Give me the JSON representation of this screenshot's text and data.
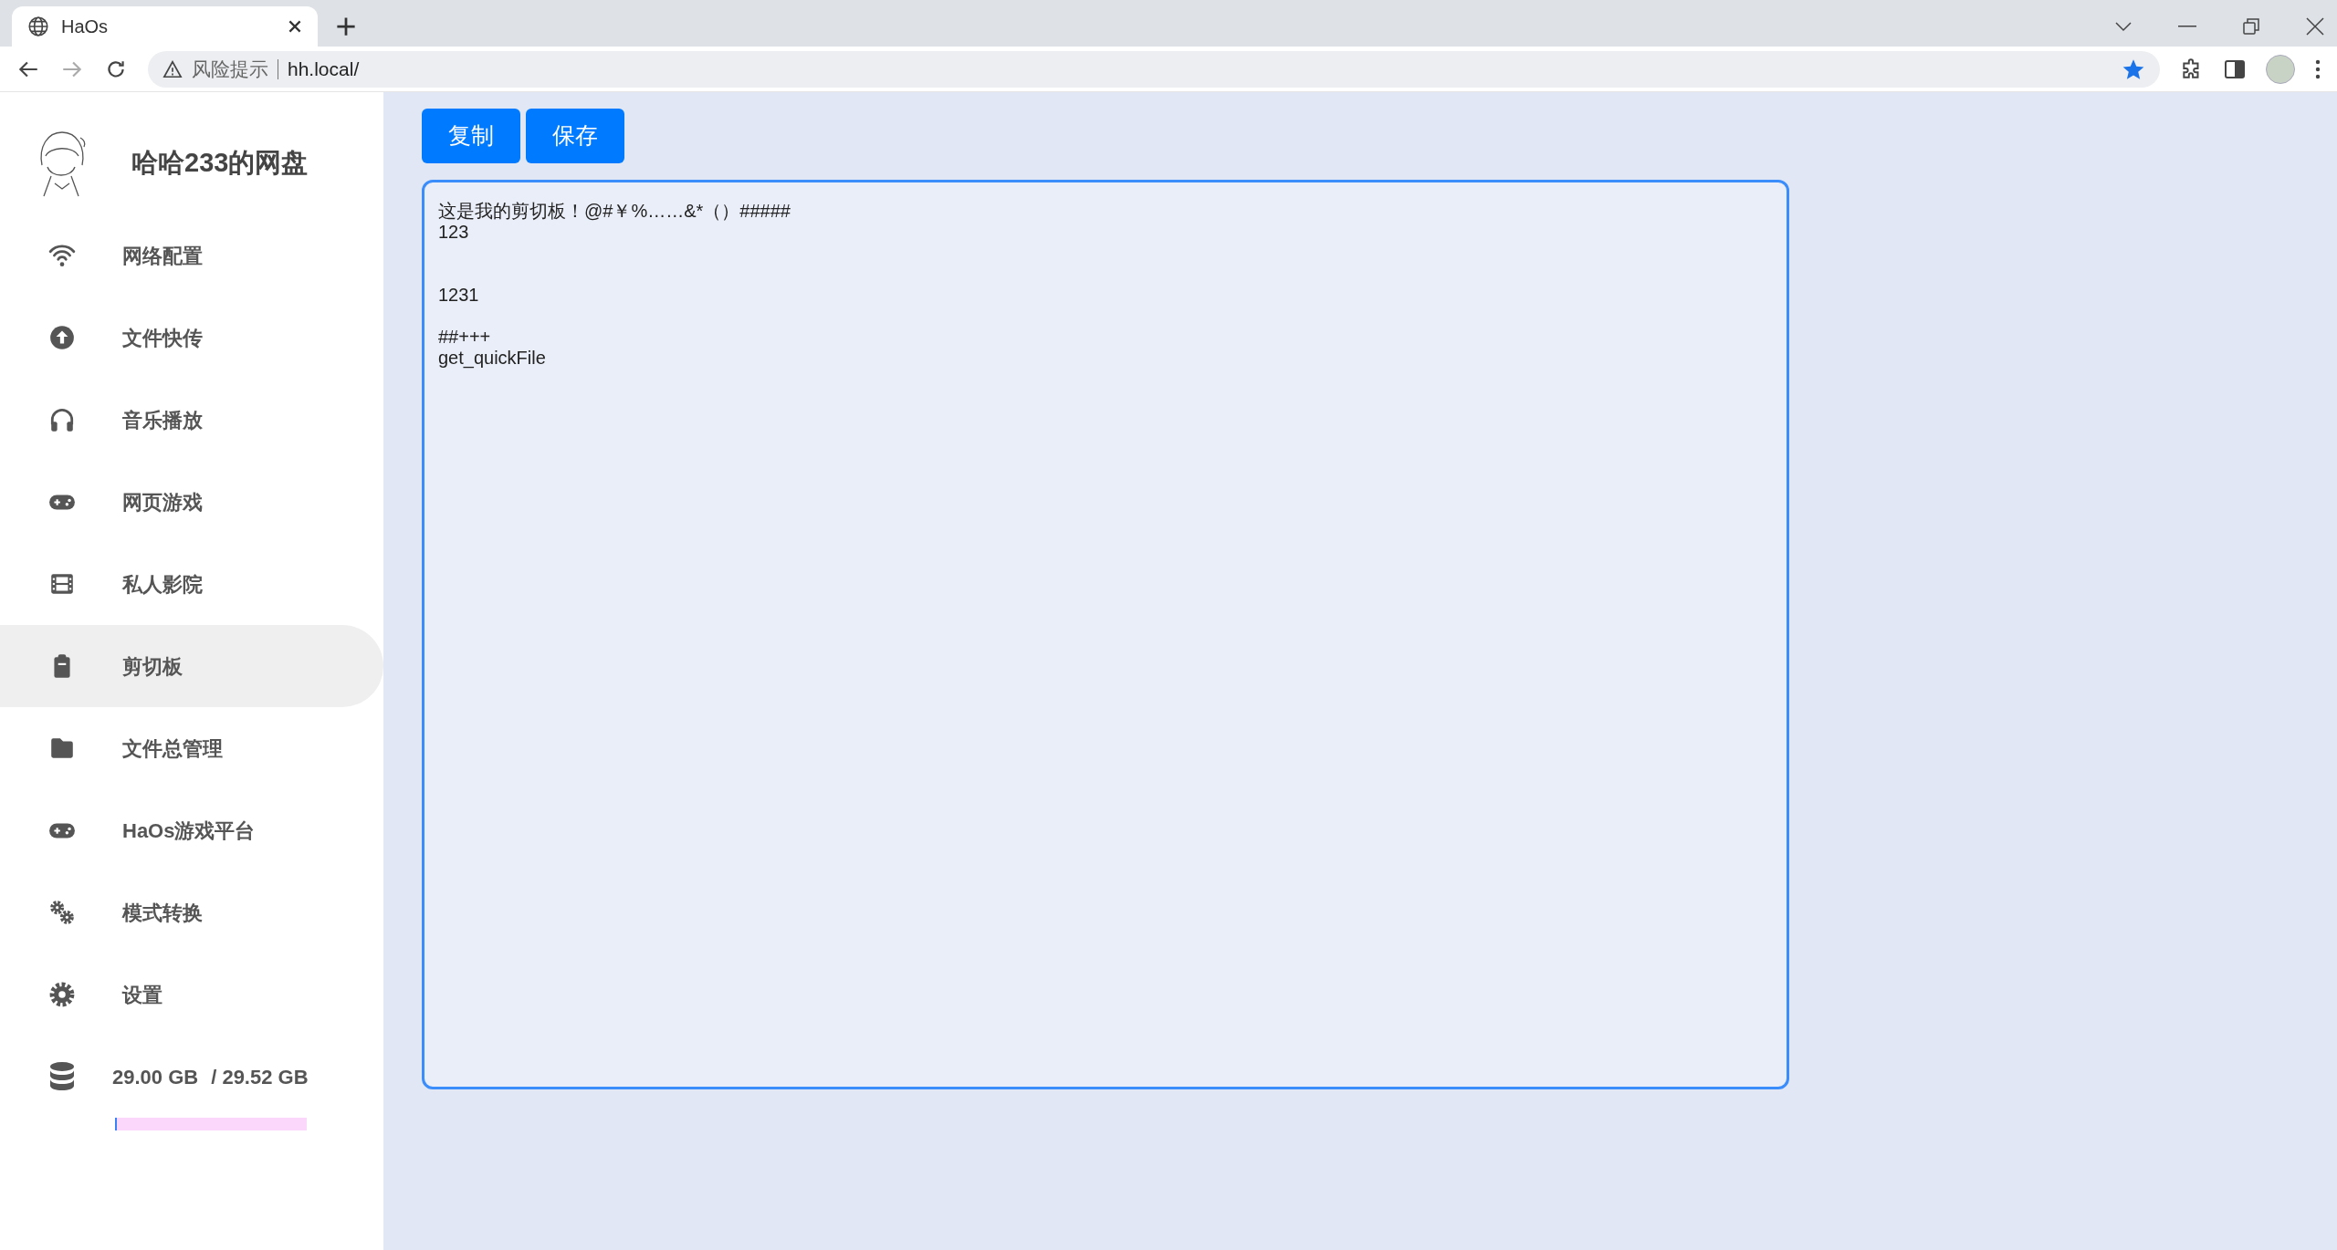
{
  "browser": {
    "tab_title": "HaOs",
    "security_label": "风险提示",
    "url": "hh.local/",
    "bookmarked": true
  },
  "sidebar": {
    "title": "哈哈233的网盘",
    "items": [
      {
        "label": "网络配置",
        "selected": false
      },
      {
        "label": "文件快传",
        "selected": false
      },
      {
        "label": "音乐播放",
        "selected": false
      },
      {
        "label": "网页游戏",
        "selected": false
      },
      {
        "label": "私人影院",
        "selected": false
      },
      {
        "label": "剪切板",
        "selected": true
      },
      {
        "label": "文件总管理",
        "selected": false
      },
      {
        "label": "HaOs游戏平台",
        "selected": false
      },
      {
        "label": "模式转换",
        "selected": false
      },
      {
        "label": "设置",
        "selected": false
      }
    ],
    "storage": {
      "used": "29.00 GB",
      "total": "/ 29.52 GB",
      "level": 0.01
    }
  },
  "buttons": [
    "复制",
    "保存"
  ],
  "clipboard": {
    "value": "这是我的剪切板！@#￥%……&*（）#####\n123\n\n\n1231\n\n##+++\nget_quickFile"
  }
}
